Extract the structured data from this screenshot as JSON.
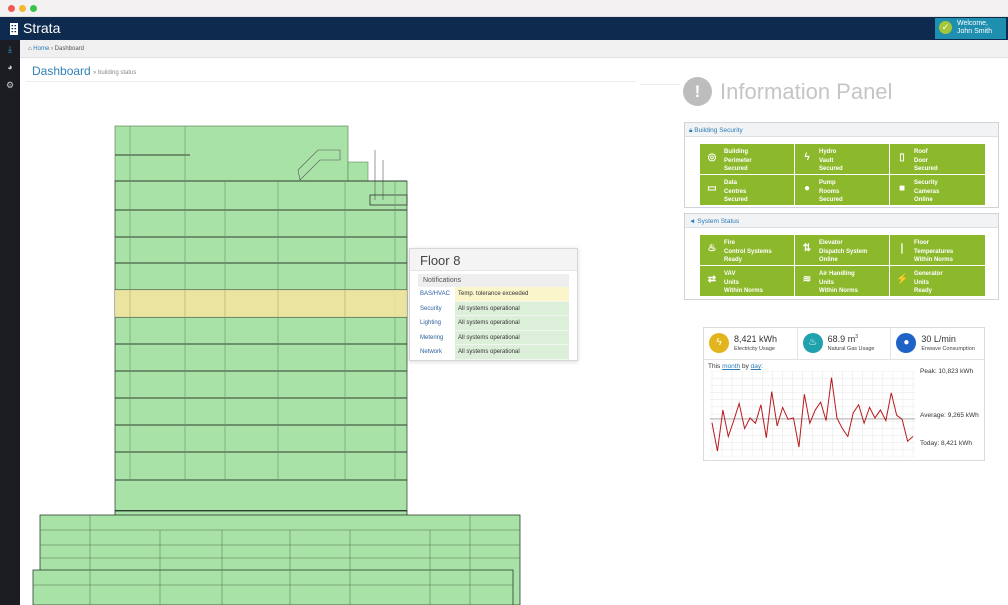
{
  "app": {
    "brand": "Strata",
    "welcome_line1": "Welcome,",
    "welcome_line2": "John Smith"
  },
  "breadcrumb": {
    "home": "Home",
    "current": "Dashboard"
  },
  "header": {
    "title": "Dashboard",
    "subtitle": "» building status"
  },
  "tooltip": {
    "floor": "Floor 8",
    "notifications_label": "Notifications",
    "rows": [
      {
        "key": "BAS/HVAC",
        "value": "Temp. tolerance exceeded",
        "status": "warn"
      },
      {
        "key": "Security",
        "value": "All systems operational",
        "status": "ok"
      },
      {
        "key": "Lighting",
        "value": "All systems operational",
        "status": "ok"
      },
      {
        "key": "Metering",
        "value": "All systems operational",
        "status": "ok"
      },
      {
        "key": "Network",
        "value": "All systems operational",
        "status": "ok"
      }
    ]
  },
  "info_panel": {
    "title": "Information Panel",
    "security": {
      "heading": "Building Security",
      "tiles": [
        {
          "icon": "target-icon",
          "lines": [
            "Building",
            "Perimeter",
            "Secured"
          ]
        },
        {
          "icon": "bolt-icon",
          "lines": [
            "Hydro",
            "Vault",
            "Secured"
          ]
        },
        {
          "icon": "door-icon",
          "lines": [
            "Roof",
            "Door",
            "Secured"
          ]
        },
        {
          "icon": "server-icon",
          "lines": [
            "Data",
            "Centres",
            "Secured"
          ]
        },
        {
          "icon": "drop-icon",
          "lines": [
            "Pump",
            "Rooms",
            "Secured"
          ]
        },
        {
          "icon": "camera-icon",
          "lines": [
            "Security",
            "Cameras",
            "Online"
          ]
        }
      ]
    },
    "system": {
      "heading": "System Status",
      "tiles": [
        {
          "icon": "extinguisher-icon",
          "lines": [
            "Fire",
            "Control Systems",
            "Ready"
          ]
        },
        {
          "icon": "elevator-icon",
          "lines": [
            "Elevator",
            "Dispatch System",
            "Online"
          ]
        },
        {
          "icon": "thermometer-icon",
          "lines": [
            "Floor",
            "Temperatures",
            "Within Norms"
          ]
        },
        {
          "icon": "vav-icon",
          "lines": [
            "VAV",
            "Units",
            "Within Norms"
          ]
        },
        {
          "icon": "air-icon",
          "lines": [
            "Air Handling",
            "Units",
            "Within Norms"
          ]
        },
        {
          "icon": "generator-icon",
          "lines": [
            "Generator",
            "Units",
            "Ready"
          ]
        }
      ]
    }
  },
  "energy": {
    "electricity": {
      "value": "8,421 kWh",
      "label": "Electricity Usage"
    },
    "gas": {
      "value": "68.9 m",
      "sup": "3",
      "label": "Natural Gas Usage"
    },
    "water": {
      "value": "30 L/min",
      "label": "Enwave Consumption"
    },
    "period_prefix": "This",
    "period_month": "month",
    "period_by": "by",
    "period_day": "day",
    "peak": "Peak: 10,823 kWh",
    "average": "Average: 9,265 kWh",
    "today": "Today: 8,421 kWh"
  },
  "colors": {
    "accent": "#2c7bb6",
    "tile_green": "#8cb82c",
    "nav_dark": "#0e2a4f",
    "chart_red": "#b8191e"
  },
  "chart_data": {
    "type": "line",
    "title": "",
    "series": [
      {
        "values": [
          9120,
          8050,
          9600,
          8600,
          9200,
          9850,
          8900,
          9300,
          9100,
          9800,
          8550,
          10300,
          9000,
          9700,
          9250,
          9300,
          8200,
          10200,
          9100,
          9600,
          9900,
          9200,
          10823,
          9300,
          8900,
          8600,
          9500,
          9800,
          9100,
          9700,
          9300,
          9600,
          9200,
          10250,
          9400,
          9250,
          8421,
          8600
        ]
      }
    ],
    "reference_lines": {
      "peak": 10823,
      "average": 9265,
      "today": 8421
    },
    "ylim": [
      7900,
      11000
    ],
    "grid": true,
    "xlabel": "",
    "ylabel": ""
  }
}
